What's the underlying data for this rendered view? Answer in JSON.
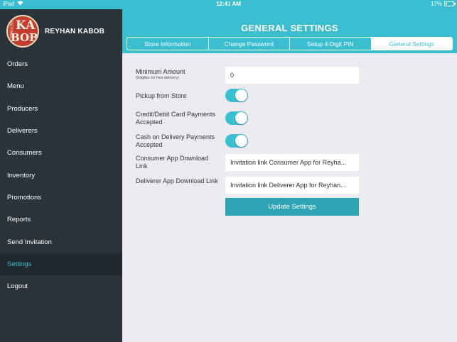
{
  "status_bar": {
    "device": "iPad",
    "time": "12:41 AM",
    "battery": "17%",
    "battery_level": 0.17
  },
  "brand": {
    "name": "REYHAN KABOB",
    "logo_text_top": "KA",
    "logo_text_bottom": "BOB",
    "logo_text_side": "REYHAN"
  },
  "page": {
    "title": "GENERAL SETTINGS"
  },
  "tabs": [
    {
      "label": "Store Information"
    },
    {
      "label": "Change Password"
    },
    {
      "label": "Setup 4-Digit PIN"
    },
    {
      "label": "General Settings",
      "active": true
    }
  ],
  "sidebar": {
    "items": [
      {
        "label": "Orders"
      },
      {
        "label": "Menu"
      },
      {
        "label": "Producers"
      },
      {
        "label": "Deliverers"
      },
      {
        "label": "Consumers"
      },
      {
        "label": "Inventory"
      },
      {
        "label": "Promotions"
      },
      {
        "label": "Reports"
      },
      {
        "label": "Send Invitation"
      },
      {
        "label": "Settings",
        "active": true
      },
      {
        "label": "Logout"
      }
    ]
  },
  "form": {
    "min_amount": {
      "label": "Minimum Amount",
      "sublabel": "(Eligible for free delivery)",
      "value": "0"
    },
    "pickup": {
      "label": "Pickup from Store",
      "on": true
    },
    "card": {
      "label": "Credit/Debit Card Payments Accepted",
      "on": true
    },
    "cod": {
      "label": "Cash on Delivery Payments Accepted",
      "on": true
    },
    "consumer_link": {
      "label": "Consumer App Download Link",
      "value": "Invitation link Consumer App for Reyha..."
    },
    "deliverer_link": {
      "label": "Deliverer App Download Link",
      "value": "Invitation link Deliverer App for Reyhan..."
    },
    "submit_label": "Update Settings"
  },
  "colors": {
    "accent": "#3bbfd0",
    "sidebar": "#2a333a",
    "button": "#2ea3b3",
    "background": "#ececf0"
  }
}
